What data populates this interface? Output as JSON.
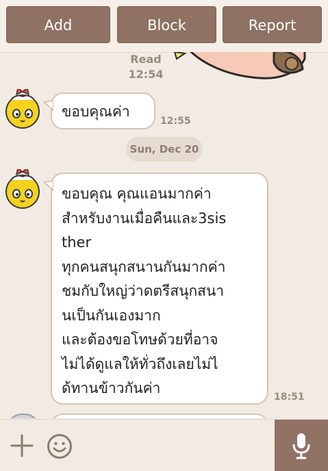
{
  "header": {
    "add_label": "Add",
    "block_label": "Block",
    "report_label": "Report"
  },
  "messages": [
    {
      "read": "Read",
      "time": "12:54"
    },
    {
      "text": "ขอบคุณค่า",
      "time": "12:55"
    },
    {
      "date": "Sun, Dec 20"
    },
    {
      "lines": [
        "ขอบคุณ คุณแอนมากค่า",
        "สำหรับงานเมื่อคืนและ3sis",
        "ther",
        "ทุกคนสนุกสนานกันมากค่า",
        "ชมกับใหญ่ว่าดตรีสนุกสนา",
        "นเป็นกันเองมาก",
        "และต้องขอโทษด้วยที่อาจ",
        "ไม่ได้ดูแลให้ทั่วถึงเลยไม่ไ",
        "ด้ทานข้าวกันค่า"
      ],
      "time": "18:51"
    }
  ],
  "icons": {
    "plus": "plus-icon",
    "emoji": "smiley-icon",
    "mic": "microphone-icon"
  },
  "colors": {
    "accent": "#8f7263",
    "background": "#f2ebe3",
    "bubble_border": "#d6c3b3"
  }
}
